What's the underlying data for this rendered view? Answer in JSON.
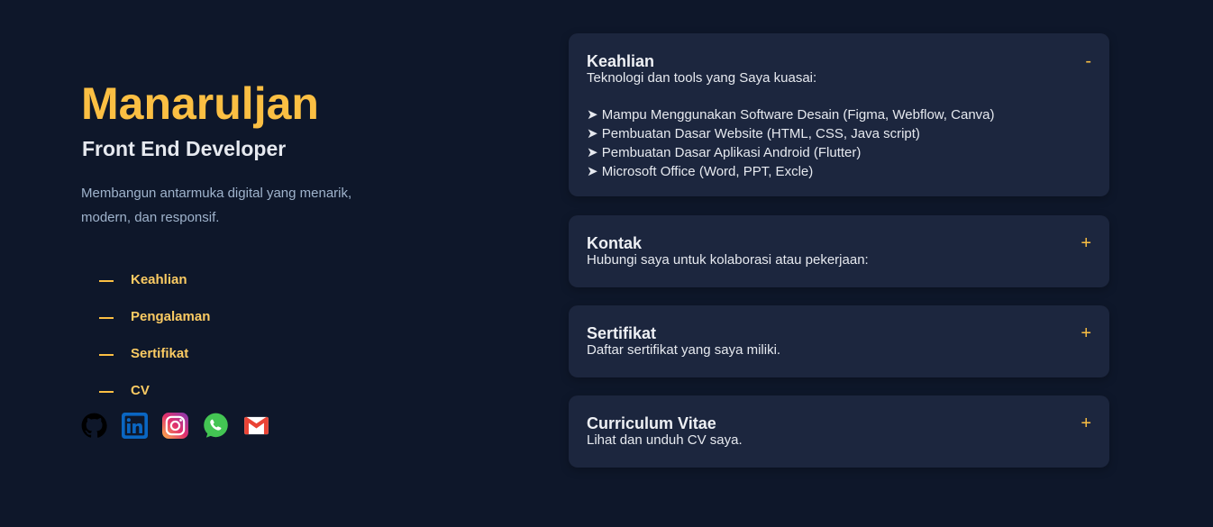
{
  "profile": {
    "name": "Manaruljan",
    "role": "Front End Developer",
    "description": "Membangun antarmuka digital yang menarik, modern, dan responsif."
  },
  "nav": {
    "items": [
      {
        "label": "Keahlian"
      },
      {
        "label": "Pengalaman"
      },
      {
        "label": "Sertifikat"
      },
      {
        "label": "CV"
      }
    ]
  },
  "socials": [
    {
      "icon": "github-icon"
    },
    {
      "icon": "linkedin-icon"
    },
    {
      "icon": "instagram-icon"
    },
    {
      "icon": "whatsapp-icon"
    },
    {
      "icon": "gmail-icon"
    }
  ],
  "cards": [
    {
      "title": "Keahlian",
      "subtitle": "Teknologi dan tools yang Saya kuasai:",
      "toggle": "-",
      "items": [
        "➤ Mampu Menggunakan Software Desain (Figma, Webflow, Canva)",
        "➤ Pembuatan Dasar Website (HTML, CSS, Java script)",
        "➤ Pembuatan Dasar Aplikasi Android (Flutter)",
        "➤ Microsoft Office (Word, PPT, Excle)"
      ]
    },
    {
      "title": "Kontak",
      "subtitle": "Hubungi saya untuk kolaborasi atau pekerjaan:",
      "toggle": "+"
    },
    {
      "title": "Sertifikat",
      "subtitle": "Daftar sertifikat yang saya miliki.",
      "toggle": "+"
    },
    {
      "title": "Curriculum Vitae",
      "subtitle": "Lihat dan unduh CV saya.",
      "toggle": "+"
    }
  ],
  "colors": {
    "background": "#0e172a",
    "accent": "#fbbf43",
    "card": "#1c263e"
  }
}
